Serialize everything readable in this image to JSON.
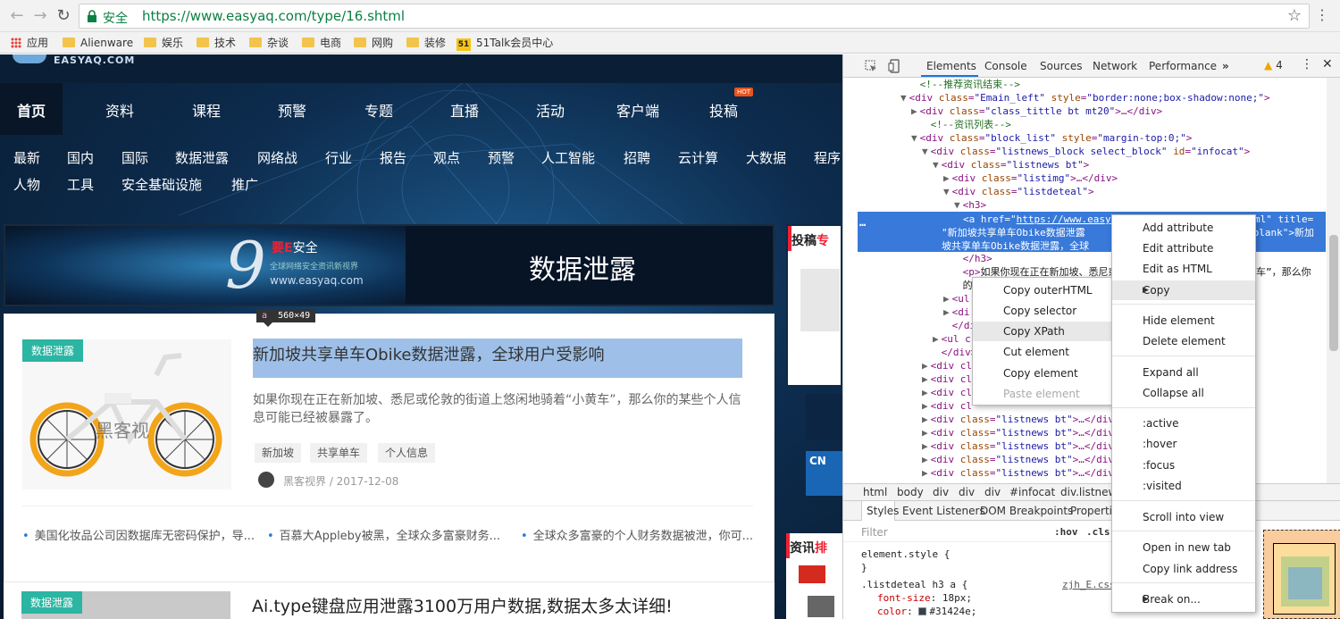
{
  "browser": {
    "secure_label": "安全",
    "url": "https://www.easyaq.com/type/16.shtml",
    "bookmarks": [
      "应用",
      "Alienware",
      "娱乐",
      "技术",
      "杂谈",
      "电商",
      "网购",
      "装修",
      "51Talk会员中心"
    ],
    "talk_badge": "51"
  },
  "site": {
    "logo": "EASYAQ.COM",
    "main_nav": [
      "首页",
      "资料",
      "课程",
      "预警",
      "专题",
      "直播",
      "活动",
      "客户端",
      "投稿"
    ],
    "hot_badge": "HOT",
    "sub_nav_row1": [
      "最新",
      "国内",
      "国际",
      "数据泄露",
      "网络战",
      "行业",
      "报告",
      "观点",
      "预警",
      "人工智能",
      "招聘",
      "云计算",
      "大数据",
      "程序"
    ],
    "sub_nav_row2": [
      "人物",
      "工具",
      "安全基础设施",
      "推广"
    ],
    "banner": {
      "nine": "9",
      "brand_prefix": "要E",
      "brand_suffix": "安全",
      "slogan": "全球网络安全资讯新视界",
      "url": "www.easyaq.com",
      "title": "数据泄露"
    },
    "sidebar": {
      "head1_a": "投稿",
      "head1_b": "专",
      "head2_a": "资讯",
      "head2_b": "排"
    },
    "article1": {
      "tag": "数据泄露",
      "title": "新加坡共享单车Obike数据泄露，全球用户受影响",
      "summary": "如果你现在正在新加坡、悉尼或伦敦的街道上悠闲地骑着“小黄车”，那么你的某些个人信息可能已经被暴露了。",
      "chips": [
        "新加坡",
        "共享单车",
        "个人信息"
      ],
      "author_line": "黑客视界 / 2017-12-08",
      "thumb_watermark": "黑客视",
      "dims_tag": "a",
      "dims": "560×49"
    },
    "related": [
      "美国化妆品公司因数据库无密码保护，导...",
      "百慕大Appleby被黑，全球众多富豪财务...",
      "全球众多富豪的个人财务数据被泄，你可..."
    ],
    "article2": {
      "tag": "数据泄露",
      "title": "Ai.type键盘应用泄露3100万用户数据,数据太多太详细!"
    }
  },
  "devtools": {
    "tabs": [
      "Elements",
      "Console",
      "Sources",
      "Network",
      "Performance"
    ],
    "more": "»",
    "warning_count": "4",
    "dom_lines": [
      {
        "indent": 4,
        "html": "<span class='cm'>&lt;!--推荐资讯结束--&gt;</span>"
      },
      {
        "indent": 3,
        "tri": "▼",
        "html": "&lt;div <span class='an'>class</span>=<span class='av'>\"Emain_left\"</span> <span class='an'>style</span>=<span class='av'>\"border:none;box-shadow:none;\"</span>&gt;"
      },
      {
        "indent": 4,
        "tri": "▶",
        "html": "&lt;div <span class='an'>class</span>=<span class='av'>\"class_tittle bt mt20\"</span>&gt;…&lt;/div&gt;"
      },
      {
        "indent": 5,
        "html": "<span class='cm'>&lt;!--资讯列表--&gt;</span>"
      },
      {
        "indent": 4,
        "tri": "▼",
        "html": "&lt;div <span class='an'>class</span>=<span class='av'>\"block_list\"</span> <span class='an'>style</span>=<span class='av'>\"margin-top:0;\"</span>&gt;"
      },
      {
        "indent": 5,
        "tri": "▼",
        "html": "&lt;div <span class='an'>class</span>=<span class='av'>\"listnews_block select_block\"</span> <span class='an'>id</span>=<span class='av'>\"infocat\"</span>&gt;"
      },
      {
        "indent": 6,
        "tri": "▼",
        "html": "&lt;div <span class='an'>class</span>=<span class='av'>\"listnews bt\"</span>&gt;"
      },
      {
        "indent": 7,
        "tri": "▶",
        "html": "&lt;div <span class='an'>class</span>=<span class='av'>\"listimg\"</span>&gt;…&lt;/div&gt;"
      },
      {
        "indent": 7,
        "tri": "▼",
        "html": "&lt;div <span class='an'>class</span>=<span class='av'>\"listdeteal\"</span>&gt;"
      },
      {
        "indent": 8,
        "tri": "▼",
        "html": "&lt;h3&gt;"
      }
    ],
    "selected_lines": [
      "&lt;a href=\"<u>https://www.easya</u>",
      "\"新加坡共享单车Obike数据泄露",
      "坡共享单车Obike数据泄露，全球"
    ],
    "selected_right": [
      "ml\" title=",
      "_blank\">新加",
      ""
    ],
    "dom_lines2": [
      {
        "indent": 8,
        "html": "&lt;/h3&gt;"
      },
      {
        "indent": 8,
        "html": "&lt;p&gt;<span class='tx'>如果你现在正在新加坡、悉尼或</span>"
      },
      {
        "indent": 8,
        "html": "<span class='tx'>的某</span>"
      },
      {
        "indent": 7,
        "tri": "▶",
        "html": "&lt;ul"
      },
      {
        "indent": 7,
        "tri": "▶",
        "html": "&lt;di"
      },
      {
        "indent": 7,
        "html": "&lt;/div"
      },
      {
        "indent": 6,
        "tri": "▶",
        "html": "&lt;ul c"
      },
      {
        "indent": 6,
        "html": "&lt;/div&gt;"
      },
      {
        "indent": 5,
        "tri": "▶",
        "html": "&lt;div cl"
      },
      {
        "indent": 5,
        "tri": "▶",
        "html": "&lt;div cl"
      },
      {
        "indent": 5,
        "tri": "▶",
        "html": "&lt;div cl"
      },
      {
        "indent": 5,
        "tri": "▶",
        "html": "&lt;div cl"
      },
      {
        "indent": 5,
        "tri": "▶",
        "html": "&lt;div <span class='an'>class</span>=<span class='av'>\"listnews bt\"</span>&gt;…&lt;/div"
      },
      {
        "indent": 5,
        "tri": "▶",
        "html": "&lt;div <span class='an'>class</span>=<span class='av'>\"listnews bt\"</span>&gt;…&lt;/div"
      },
      {
        "indent": 5,
        "tri": "▶",
        "html": "&lt;div <span class='an'>class</span>=<span class='av'>\"listnews bt\"</span>&gt;…&lt;/div"
      },
      {
        "indent": 5,
        "tri": "▶",
        "html": "&lt;div <span class='an'>class</span>=<span class='av'>\"listnews bt\"</span>&gt;…&lt;/div"
      },
      {
        "indent": 5,
        "tri": "▶",
        "html": "&lt;div <span class='an'>class</span>=<span class='av'>\"listnews bt\"</span>&gt;…&lt;/div"
      }
    ],
    "p_tail": "车”，那么你",
    "breadcrumbs": [
      "html",
      "body",
      "div",
      "div",
      "div",
      "#infocat",
      "div.listnews"
    ],
    "styles_tabs": [
      "Styles",
      "Event Listeners",
      "DOM Breakpoints",
      "Properties"
    ],
    "filter_placeholder": "Filter",
    "filter_hov": ":hov",
    "filter_cls": ".cls",
    "css": {
      "element_style": "element.style {",
      "close": "}",
      "selector": ".listdeteal h3 a {",
      "source": "zjh_E.css",
      "prop1": "font-size",
      "val1": "18px;",
      "prop2": "color",
      "val2": "#31424e;"
    }
  },
  "context_menu_main": {
    "items": [
      "Add attribute",
      "Edit attribute",
      "Edit as HTML",
      "Copy",
      "Hide element",
      "Delete element",
      "Expand all",
      "Collapse all",
      ":active",
      ":hover",
      ":focus",
      ":visited",
      "Scroll into view",
      "Open in new tab",
      "Copy link address",
      "Break on..."
    ]
  },
  "context_menu_copy": {
    "items": [
      "Copy outerHTML",
      "Copy selector",
      "Copy XPath",
      "Cut element",
      "Copy element",
      "Paste element"
    ]
  }
}
